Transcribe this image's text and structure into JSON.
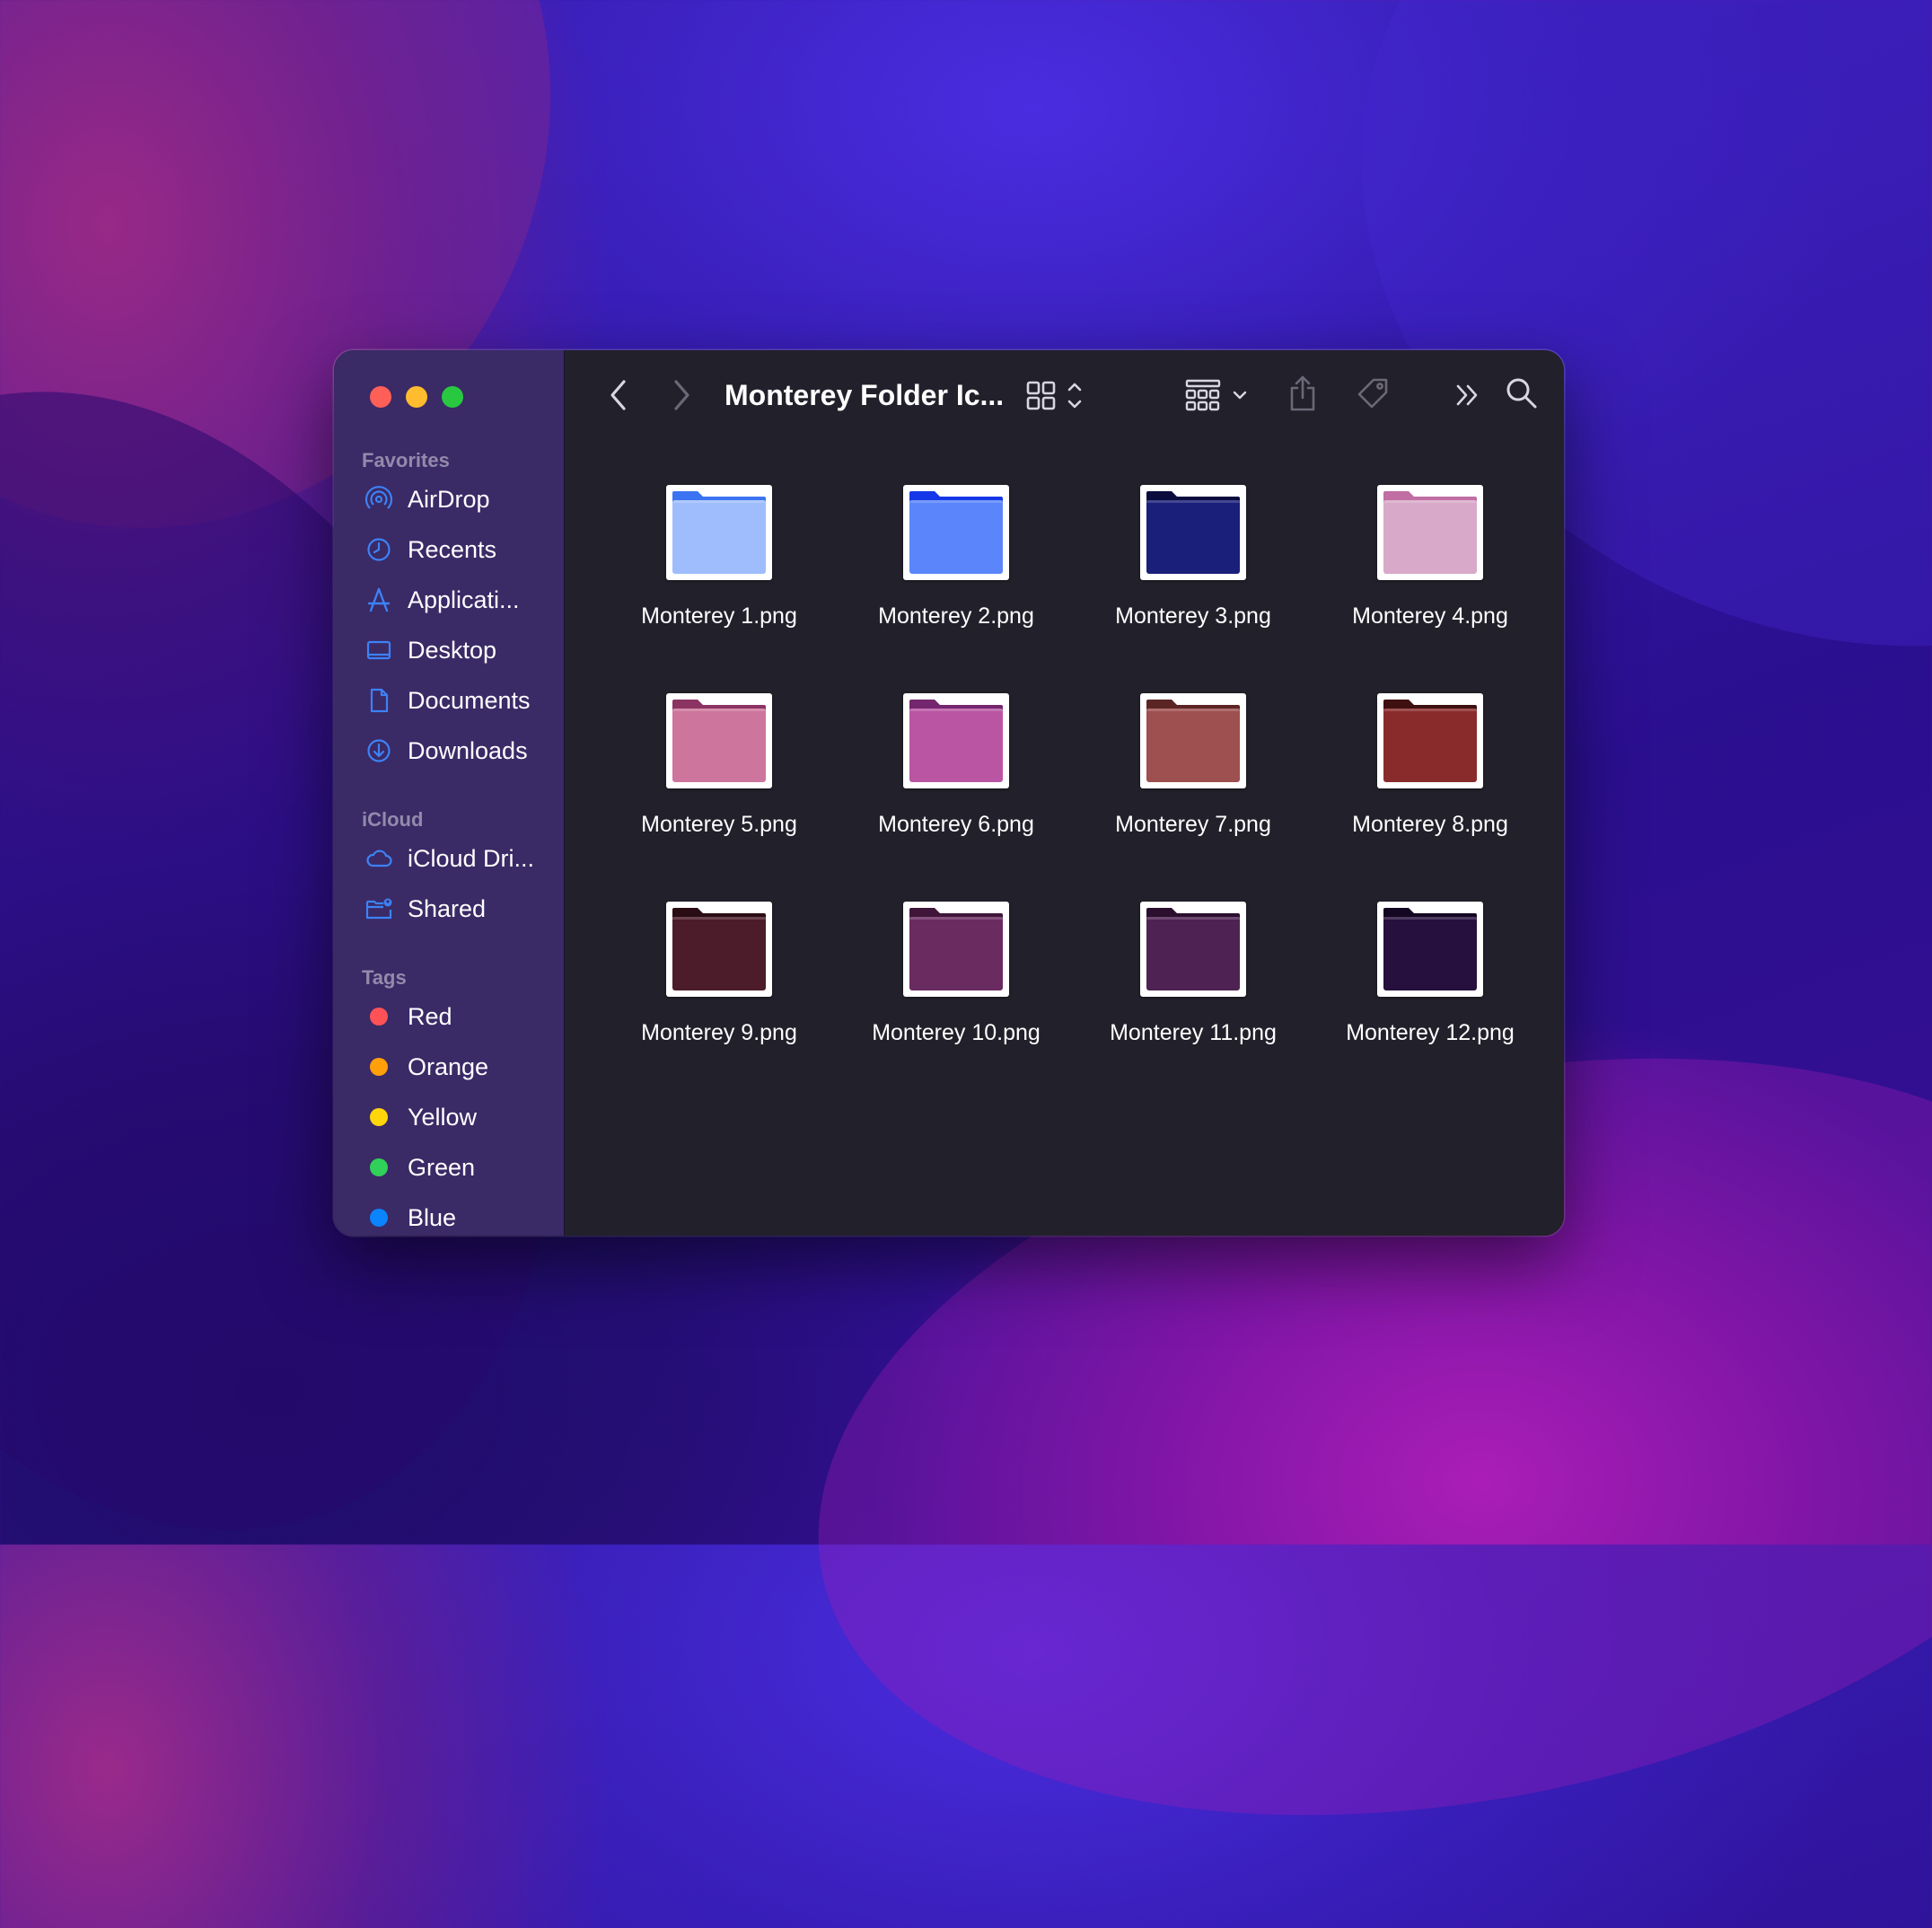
{
  "window": {
    "title": "Monterey Folder Ic..."
  },
  "sidebar": {
    "favorites_heading": "Favorites",
    "favorites": [
      {
        "label": "AirDrop",
        "icon": "airdrop-icon"
      },
      {
        "label": "Recents",
        "icon": "clock-icon"
      },
      {
        "label": "Applicati...",
        "icon": "applications-icon"
      },
      {
        "label": "Desktop",
        "icon": "desktop-icon"
      },
      {
        "label": "Documents",
        "icon": "document-icon"
      },
      {
        "label": "Downloads",
        "icon": "download-icon"
      }
    ],
    "icloud_heading": "iCloud",
    "icloud": [
      {
        "label": "iCloud Dri...",
        "icon": "cloud-icon"
      },
      {
        "label": "Shared",
        "icon": "shared-folder-icon"
      }
    ],
    "tags_heading": "Tags",
    "tags": [
      {
        "label": "Red",
        "color": "#ff5257"
      },
      {
        "label": "Orange",
        "color": "#ff9f0a"
      },
      {
        "label": "Yellow",
        "color": "#ffd60a"
      },
      {
        "label": "Green",
        "color": "#30d158"
      },
      {
        "label": "Blue",
        "color": "#0a84ff"
      }
    ]
  },
  "files": [
    {
      "name": "Monterey 1.png",
      "body": "#9fbdfc",
      "tab": "#3b74f2"
    },
    {
      "name": "Monterey 2.png",
      "body": "#5b86fb",
      "tab": "#1537e8"
    },
    {
      "name": "Monterey 3.png",
      "body": "#1a1f7a",
      "tab": "#0b0c3e"
    },
    {
      "name": "Monterey 4.png",
      "body": "#d8a9c8",
      "tab": "#c06ea3"
    },
    {
      "name": "Monterey 5.png",
      "body": "#cd759c",
      "tab": "#8b3363"
    },
    {
      "name": "Monterey 6.png",
      "body": "#b955a3",
      "tab": "#74266e"
    },
    {
      "name": "Monterey 7.png",
      "body": "#9e4f4f",
      "tab": "#5c2525"
    },
    {
      "name": "Monterey 8.png",
      "body": "#8a2b2b",
      "tab": "#3f1010"
    },
    {
      "name": "Monterey 9.png",
      "body": "#4c1c2a",
      "tab": "#2a0c14"
    },
    {
      "name": "Monterey 10.png",
      "body": "#6a2b61",
      "tab": "#3f1639"
    },
    {
      "name": "Monterey 11.png",
      "body": "#4e2252",
      "tab": "#2b0f2e"
    },
    {
      "name": "Monterey 12.png",
      "body": "#26103d",
      "tab": "#140722"
    }
  ],
  "colors": {
    "accent": "#3b82f6",
    "sidebar_bg": "#3a2a66",
    "content_bg": "#22202a"
  }
}
